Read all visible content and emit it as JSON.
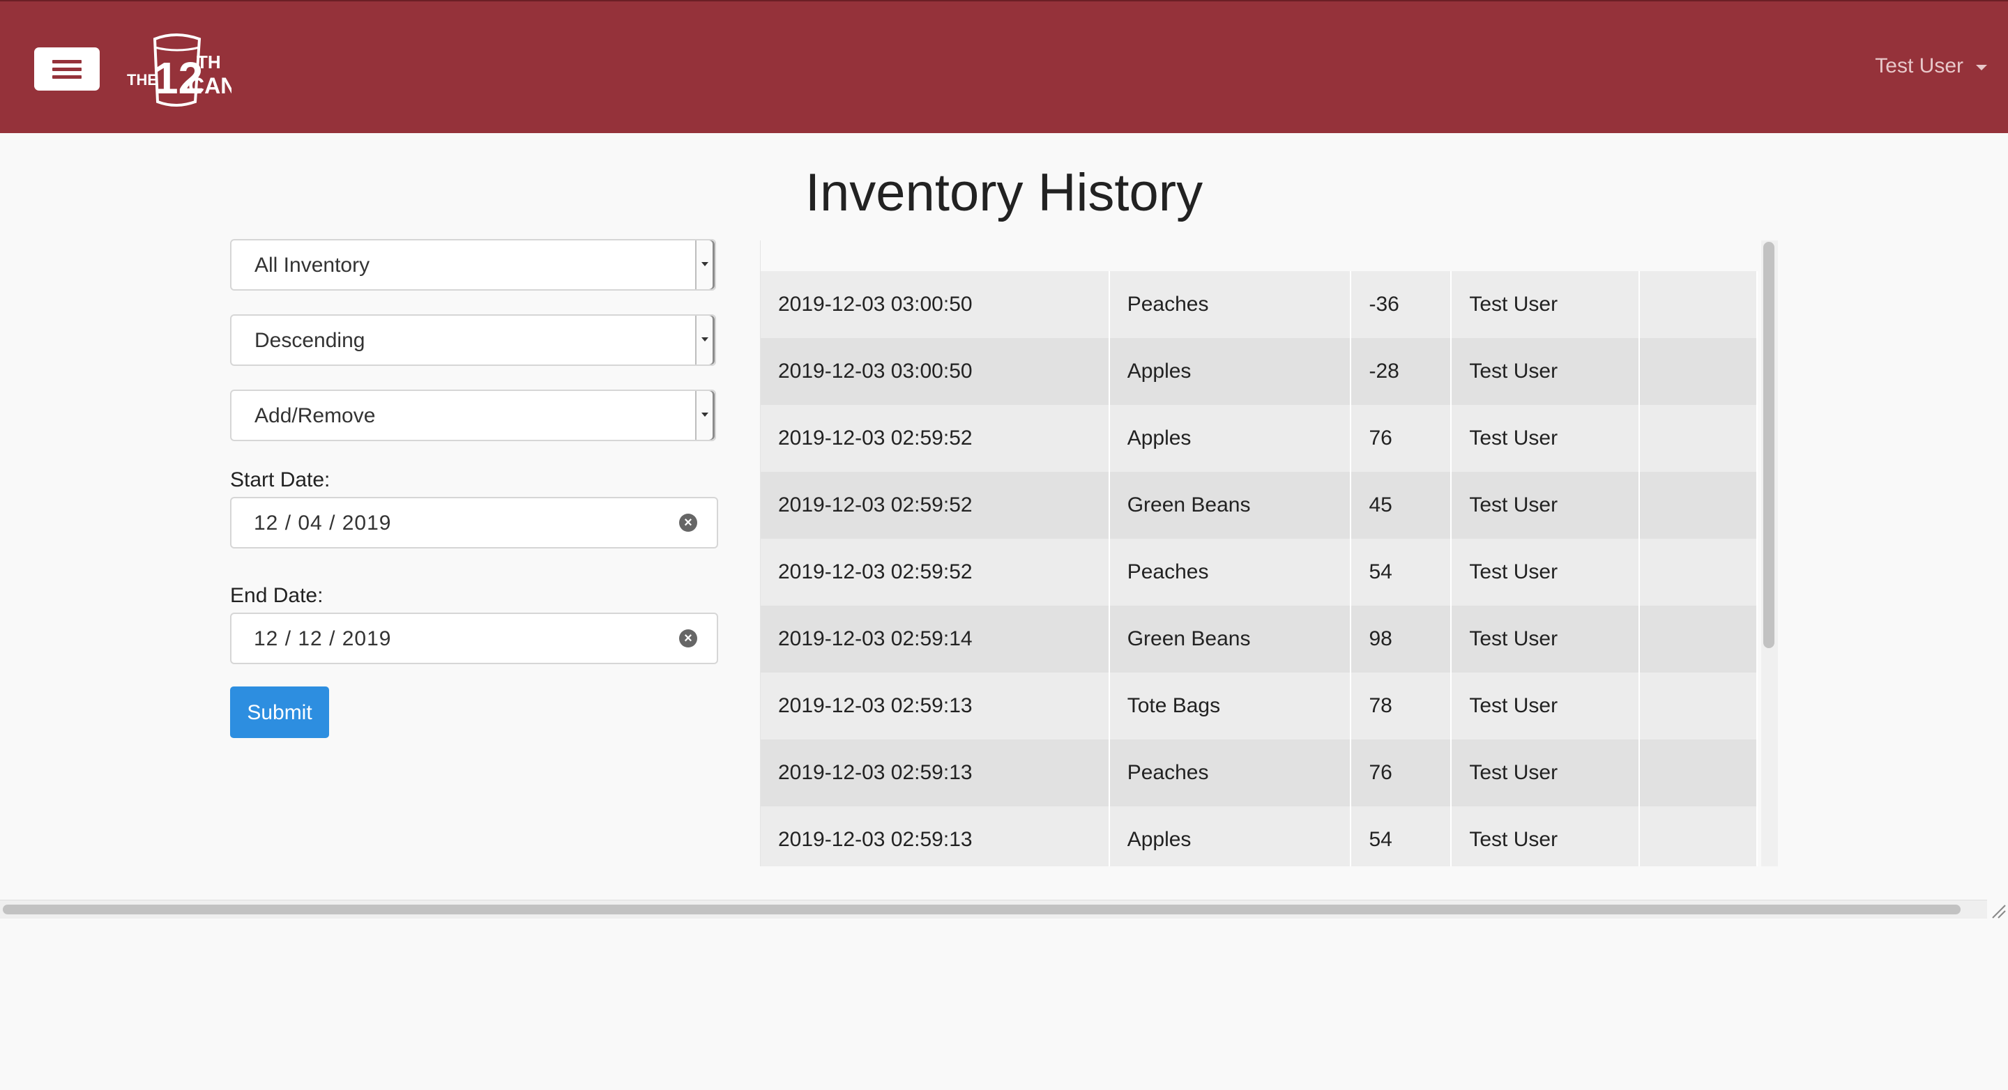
{
  "header": {
    "logo_alt": "THE 12TH CAN",
    "user_name": "Test User",
    "colors": {
      "bar": "#95323a",
      "accent": "#2d8ee0"
    }
  },
  "page": {
    "title": "Inventory History"
  },
  "filters": {
    "inventory_select": "All Inventory",
    "order_select": "Descending",
    "type_select": "Add/Remove",
    "start_date_label": "Start Date:",
    "start_date": "12 / 04 / 2019",
    "end_date_label": "End Date:",
    "end_date": "12 / 12 / 2019",
    "submit_label": "Submit"
  },
  "history": {
    "rows": [
      {
        "time": "2019-12-03 03:00:50",
        "item": "Peaches",
        "qty": "-36",
        "user": "Test User"
      },
      {
        "time": "2019-12-03 03:00:50",
        "item": "Apples",
        "qty": "-28",
        "user": "Test User"
      },
      {
        "time": "2019-12-03 02:59:52",
        "item": "Apples",
        "qty": "76",
        "user": "Test User"
      },
      {
        "time": "2019-12-03 02:59:52",
        "item": "Green Beans",
        "qty": "45",
        "user": "Test User"
      },
      {
        "time": "2019-12-03 02:59:52",
        "item": "Peaches",
        "qty": "54",
        "user": "Test User"
      },
      {
        "time": "2019-12-03 02:59:14",
        "item": "Green Beans",
        "qty": "98",
        "user": "Test User"
      },
      {
        "time": "2019-12-03 02:59:13",
        "item": "Tote Bags",
        "qty": "78",
        "user": "Test User"
      },
      {
        "time": "2019-12-03 02:59:13",
        "item": "Peaches",
        "qty": "76",
        "user": "Test User"
      },
      {
        "time": "2019-12-03 02:59:13",
        "item": "Apples",
        "qty": "54",
        "user": "Test User"
      }
    ]
  }
}
